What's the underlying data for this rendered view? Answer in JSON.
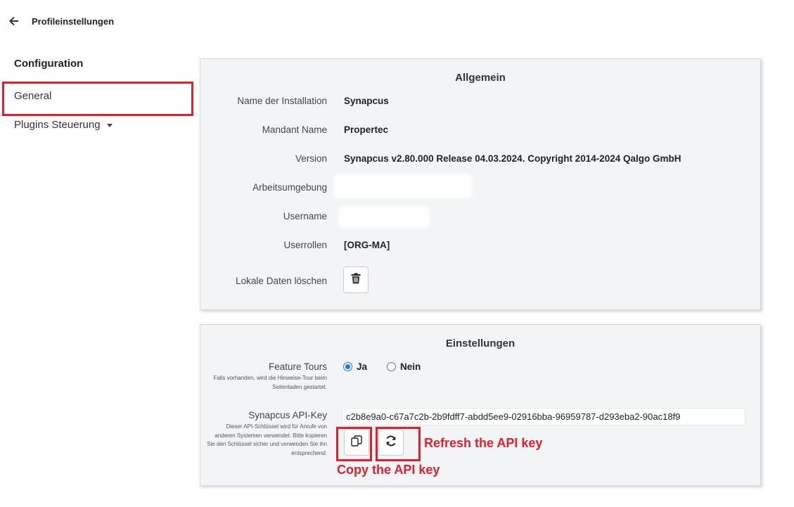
{
  "header": {
    "title": "Profileinstellungen",
    "back_icon": "arrow-left-icon"
  },
  "sidebar": {
    "heading": "Configuration",
    "items": [
      {
        "label": "General"
      },
      {
        "label": "Plugins Steuerung",
        "icon": "caret-down-icon"
      }
    ]
  },
  "general_panel": {
    "title": "Allgemein",
    "rows": [
      {
        "label": "Name der Installation",
        "value": "Synapcus"
      },
      {
        "label": "Mandant Name",
        "value": "Propertec"
      },
      {
        "label": "Version",
        "value": "Synapcus v2.80.000 Release 04.03.2024. Copyright 2014-2024 Qalgo GmbH"
      },
      {
        "label": "Arbeitsumgebung",
        "value": ""
      },
      {
        "label": "Username",
        "value": ""
      },
      {
        "label": "Userrollen",
        "value": "[ORG-MA]"
      },
      {
        "label": "Lokale Daten löschen",
        "icon": "trash-icon"
      }
    ]
  },
  "settings_panel": {
    "title": "Einstellungen",
    "feature_tours": {
      "label": "Feature Tours",
      "help": "Falls vorhanden, wird die Hinweise-Tour beim Seitenladen gestartet.",
      "options": [
        "Ja",
        "Nein"
      ],
      "selected": "Ja"
    },
    "api_key": {
      "label": "Synapcus API-Key",
      "help": "Dieser API-Schlüssel wird für Anrufe von anderen Systemen verwendet. Bitte kopieren Sie den Schlüssel sicher und verwenden Sie ihn entsprechend.",
      "value": "c2b8e9a0-c67a7c2b-2b9fdff7-abdd5ee9-02916bba-96959787-d293eba2-90ac18f9",
      "copy_icon": "copy-icon",
      "refresh_icon": "refresh-icon"
    }
  },
  "annotations": {
    "refresh": "Refresh the API key",
    "copy": "Copy the API key",
    "color": "#e0202c"
  }
}
